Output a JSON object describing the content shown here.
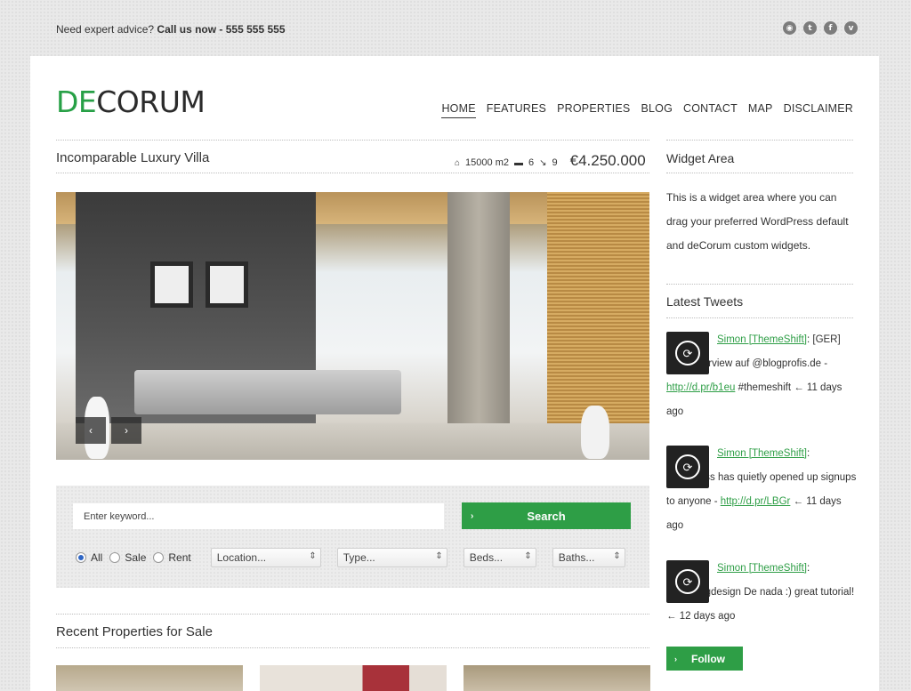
{
  "topbar": {
    "advice": "Need expert advice?",
    "call": "Call us now - 555 555 555",
    "social": [
      "rss-icon",
      "twitter-icon",
      "facebook-icon",
      "vimeo-icon"
    ]
  },
  "logo": {
    "de": "DE",
    "rest": "CORUM"
  },
  "nav": [
    "HOME",
    "FEATURES",
    "PROPERTIES",
    "BLOG",
    "CONTACT",
    "MAP",
    "DISCLAIMER"
  ],
  "listing": {
    "title": "Incomparable Luxury Villa",
    "area": "15000 m2",
    "beds": "6",
    "baths": "9",
    "price": "€4.250.000"
  },
  "slider": {
    "prev": "‹",
    "next": "›"
  },
  "search": {
    "placeholder": "Enter keyword...",
    "button": "Search",
    "radios": [
      "All",
      "Sale",
      "Rent"
    ],
    "selects": [
      "Location...",
      "Type...",
      "Beds...",
      "Baths..."
    ]
  },
  "recent": {
    "title": "Recent Properties for Sale"
  },
  "sidebar": {
    "widget_title": "Widget Area",
    "widget_text": "This is a widget area where you can drag your preferred WordPress default and deCorum custom widgets.",
    "tweets_title": "Latest Tweets",
    "tweets": [
      {
        "user": "Simon [ThemeShift]",
        "pre": ": [GER] Mein Interview auf @blogprofis.de - ",
        "link": "http://d.pr/b1eu",
        "post": " #themeshift ← 11 days ago"
      },
      {
        "user": "Simon [ThemeShift]",
        "pre": ": VaultPress has quietly opened up signups to anyone - ",
        "link": "http://d.pr/LBGr",
        "post": " ← 11 days ago"
      },
      {
        "user": "Simon [ThemeShift]",
        "pre": ": @problogdesign De nada :) great tutorial! ← 12 days ago",
        "link": "",
        "post": ""
      }
    ],
    "follow": "Follow"
  }
}
